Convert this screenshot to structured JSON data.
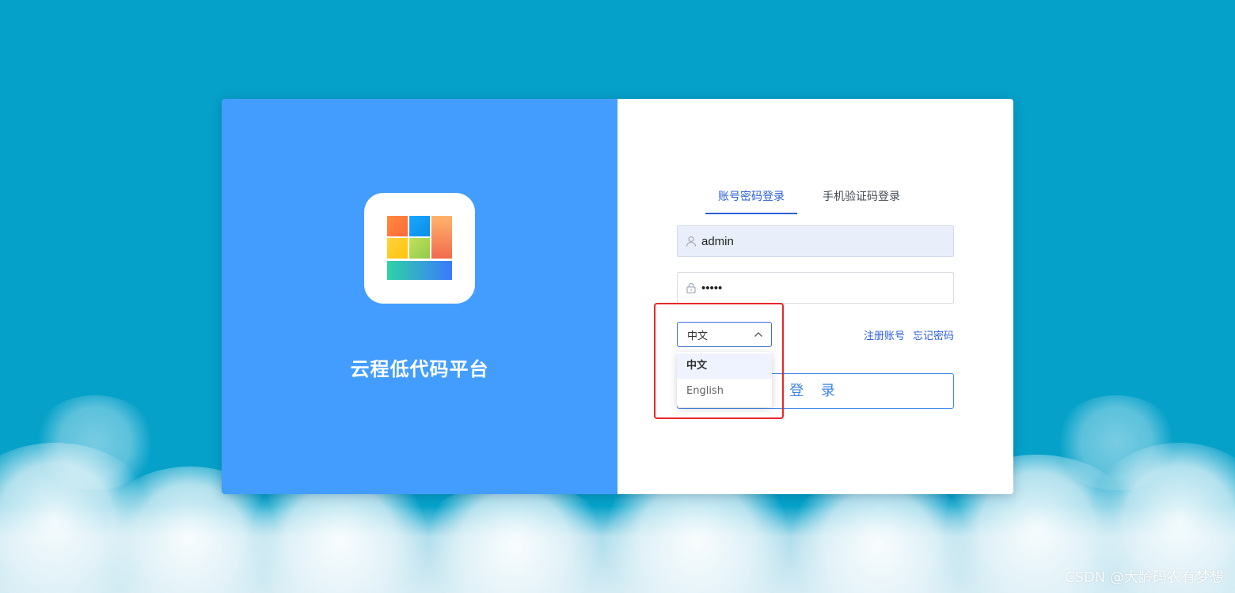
{
  "brand": {
    "title": "云程低代码平台",
    "logo_icon": "grid-logo-icon"
  },
  "login": {
    "tabs": [
      {
        "label": "账号密码登录",
        "active": true
      },
      {
        "label": "手机验证码登录",
        "active": false
      }
    ],
    "username": {
      "value": "admin",
      "icon": "user-icon"
    },
    "password": {
      "value": "•••••",
      "icon": "lock-icon"
    },
    "language": {
      "selected": "中文",
      "options": [
        {
          "label": "中文",
          "selected": true
        },
        {
          "label": "English",
          "selected": false
        }
      ]
    },
    "links": {
      "register": "注册账号",
      "forgot": "忘记密码"
    },
    "submit_label": "登 录"
  },
  "watermark": "CSDN @大龄码农有梦想",
  "colors": {
    "background": "#05a1c9",
    "brand_panel": "#429dff",
    "accent": "#2b5fd9",
    "highlight": "#e8262b"
  }
}
